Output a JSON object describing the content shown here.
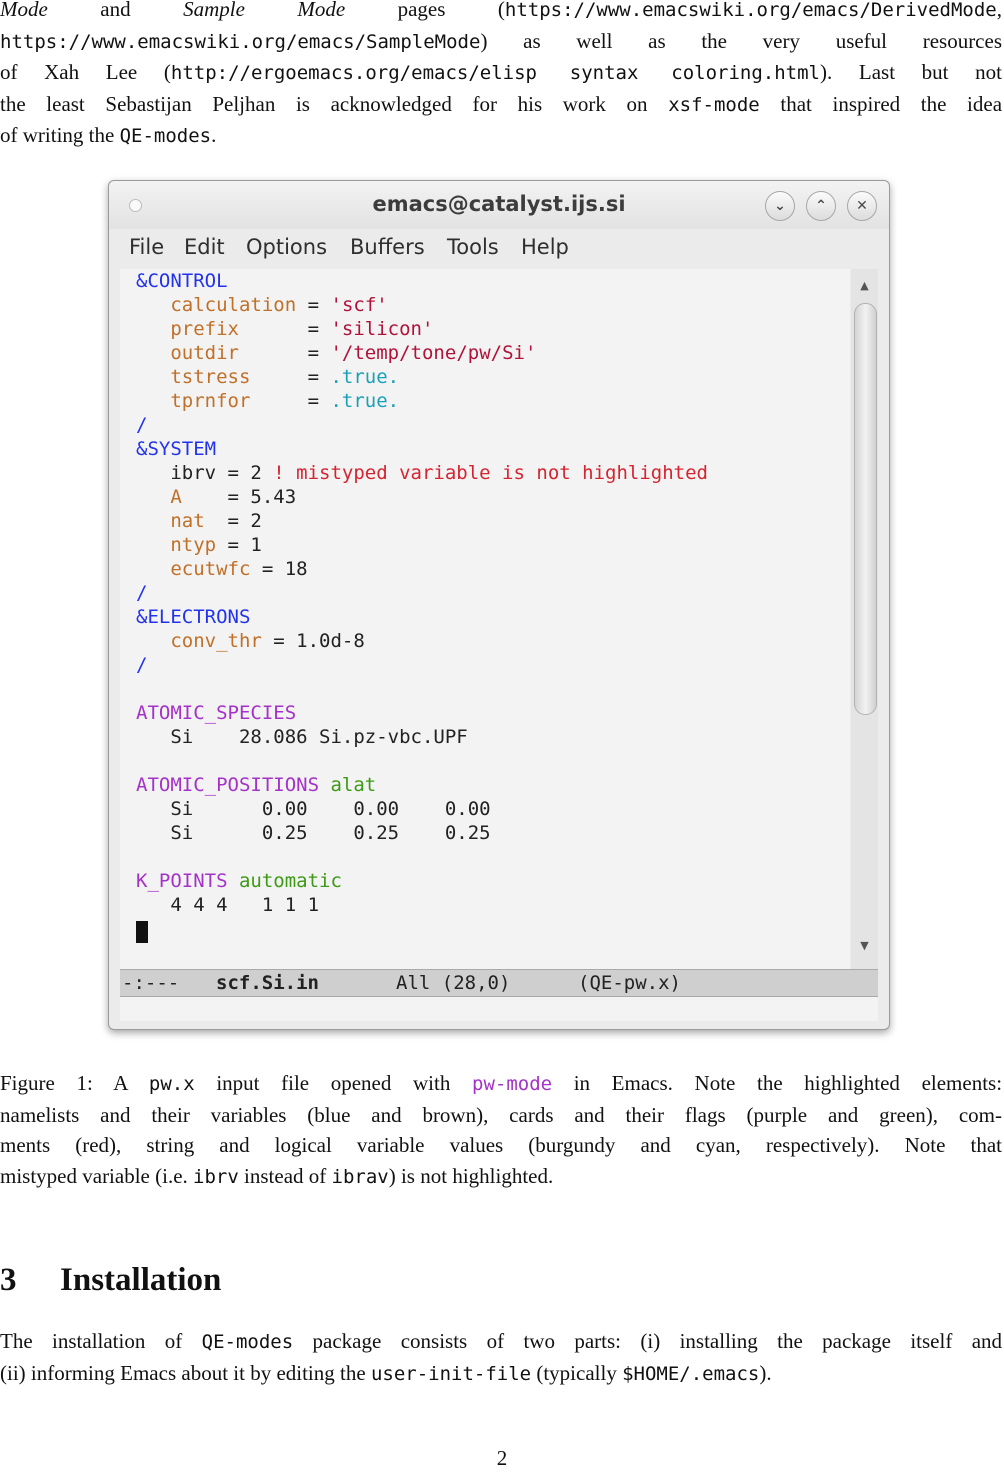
{
  "intro": {
    "l1_a": "Mode",
    "l1_b": "and",
    "l1_c": "Sample Mode",
    "l1_d": "pages (",
    "l1_e": "https://www.emacswiki.org/emacs/DerivedMode",
    "l1_f": ",",
    "l2_a": "https://www.emacswiki.org/emacs/SampleMode",
    "l2_b": ") as well as the very useful resources",
    "l3_a": "of Xah Lee (",
    "l3_b": "http://ergoemacs.org/emacs/elisp syntax coloring.html",
    "l3_c": "). Last but not",
    "l4_a": "the least Sebastijan Peljhan is acknowledged for his work on",
    "l4_b": "xsf-mode",
    "l4_c": "that inspired the idea",
    "l5_a": "of writing the",
    "l5_b": "QE-modes",
    "l5_c": "."
  },
  "window": {
    "title": "emacs@catalyst.ijs.si",
    "buttons": [
      "⌄",
      "⌃",
      "✕"
    ],
    "menu": [
      "File",
      "Edit",
      "Options",
      "Buffers",
      "Tools",
      "Help"
    ],
    "lines": [
      {
        "segs": [
          {
            "t": "&CONTROL",
            "c": "nl"
          }
        ]
      },
      {
        "segs": [
          {
            "t": "   ",
            "c": "plain"
          },
          {
            "t": "calculation",
            "c": "var"
          },
          {
            "t": " = ",
            "c": "plain"
          },
          {
            "t": "'scf'",
            "c": "str"
          }
        ]
      },
      {
        "segs": [
          {
            "t": "   ",
            "c": "plain"
          },
          {
            "t": "prefix",
            "c": "var"
          },
          {
            "t": "      = ",
            "c": "plain"
          },
          {
            "t": "'silicon'",
            "c": "str"
          }
        ]
      },
      {
        "segs": [
          {
            "t": "   ",
            "c": "plain"
          },
          {
            "t": "outdir",
            "c": "var"
          },
          {
            "t": "      = ",
            "c": "plain"
          },
          {
            "t": "'/temp/tone/pw/Si'",
            "c": "str"
          }
        ]
      },
      {
        "segs": [
          {
            "t": "   ",
            "c": "plain"
          },
          {
            "t": "tstress",
            "c": "var"
          },
          {
            "t": "     = ",
            "c": "plain"
          },
          {
            "t": ".true.",
            "c": "bool"
          }
        ]
      },
      {
        "segs": [
          {
            "t": "   ",
            "c": "plain"
          },
          {
            "t": "tprnfor",
            "c": "var"
          },
          {
            "t": "     = ",
            "c": "plain"
          },
          {
            "t": ".true.",
            "c": "bool"
          }
        ]
      },
      {
        "segs": [
          {
            "t": "/",
            "c": "nl"
          }
        ]
      },
      {
        "segs": [
          {
            "t": "&SYSTEM",
            "c": "nl"
          }
        ]
      },
      {
        "segs": [
          {
            "t": "   ibrv = 2 ",
            "c": "plain"
          },
          {
            "t": "! mistyped variable is not highlighted",
            "c": "com"
          }
        ]
      },
      {
        "segs": [
          {
            "t": "   ",
            "c": "plain"
          },
          {
            "t": "A",
            "c": "var"
          },
          {
            "t": "    = 5.43",
            "c": "plain"
          }
        ]
      },
      {
        "segs": [
          {
            "t": "   ",
            "c": "plain"
          },
          {
            "t": "nat",
            "c": "var"
          },
          {
            "t": "  = 2",
            "c": "plain"
          }
        ]
      },
      {
        "segs": [
          {
            "t": "   ",
            "c": "plain"
          },
          {
            "t": "ntyp",
            "c": "var"
          },
          {
            "t": " = 1",
            "c": "plain"
          }
        ]
      },
      {
        "segs": [
          {
            "t": "   ",
            "c": "plain"
          },
          {
            "t": "ecutwfc",
            "c": "var"
          },
          {
            "t": " = 18",
            "c": "plain"
          }
        ]
      },
      {
        "segs": [
          {
            "t": "/",
            "c": "nl"
          }
        ]
      },
      {
        "segs": [
          {
            "t": "&ELECTRONS",
            "c": "nl"
          }
        ]
      },
      {
        "segs": [
          {
            "t": "   ",
            "c": "plain"
          },
          {
            "t": "conv_thr",
            "c": "var"
          },
          {
            "t": " = 1.0d-8",
            "c": "plain"
          }
        ]
      },
      {
        "segs": [
          {
            "t": "/",
            "c": "nl"
          }
        ]
      },
      {
        "segs": []
      },
      {
        "segs": [
          {
            "t": "ATOMIC_SPECIES",
            "c": "card"
          }
        ]
      },
      {
        "segs": [
          {
            "t": "   Si    28.086 Si.pz-vbc.UPF",
            "c": "plain"
          }
        ]
      },
      {
        "segs": []
      },
      {
        "segs": [
          {
            "t": "ATOMIC_POSITIONS",
            "c": "card"
          },
          {
            "t": " ",
            "c": "plain"
          },
          {
            "t": "alat",
            "c": "flag"
          }
        ]
      },
      {
        "segs": [
          {
            "t": "   Si      0.00    0.00    0.00",
            "c": "plain"
          }
        ]
      },
      {
        "segs": [
          {
            "t": "   Si      0.25    0.25    0.25",
            "c": "plain"
          }
        ]
      },
      {
        "segs": []
      },
      {
        "segs": [
          {
            "t": "K_POINTS",
            "c": "card"
          },
          {
            "t": " ",
            "c": "plain"
          },
          {
            "t": "automatic",
            "c": "flag"
          }
        ]
      },
      {
        "segs": [
          {
            "t": "   4 4 4   1 1 1",
            "c": "plain"
          }
        ]
      }
    ],
    "modeline": {
      "status": "-:---",
      "buffer": "scf.Si.in",
      "position": "All (28,0)",
      "mode": "(QE-pw.x)"
    }
  },
  "caption": {
    "a": "Figure 1: A",
    "b": "pw.x",
    "c": "input file opened with",
    "d": "pw-mode",
    "e": "in Emacs. Note the highlighted elements:",
    "l2": "namelists and their variables (blue and brown), cards and their flags (purple and green), com-",
    "l3": "ments (red), string and logical variable values (burgundy and cyan, respectively). Note that",
    "l4_a": "mistyped variable (i.e.",
    "l4_b": "ibrv",
    "l4_c": "instead of",
    "l4_d": "ibrav",
    "l4_e": ") is not highlighted."
  },
  "section": {
    "number": "3",
    "title": "Installation"
  },
  "install": {
    "a": "The installation of",
    "b": "QE-modes",
    "c": "package consists of two parts: (i) installing the package itself and",
    "d": "(ii) informing Emacs about it by editing the",
    "e": "user-init-file",
    "f": "(typically",
    "g": "$HOME/.emacs",
    "h": ")."
  },
  "page_number": "2"
}
